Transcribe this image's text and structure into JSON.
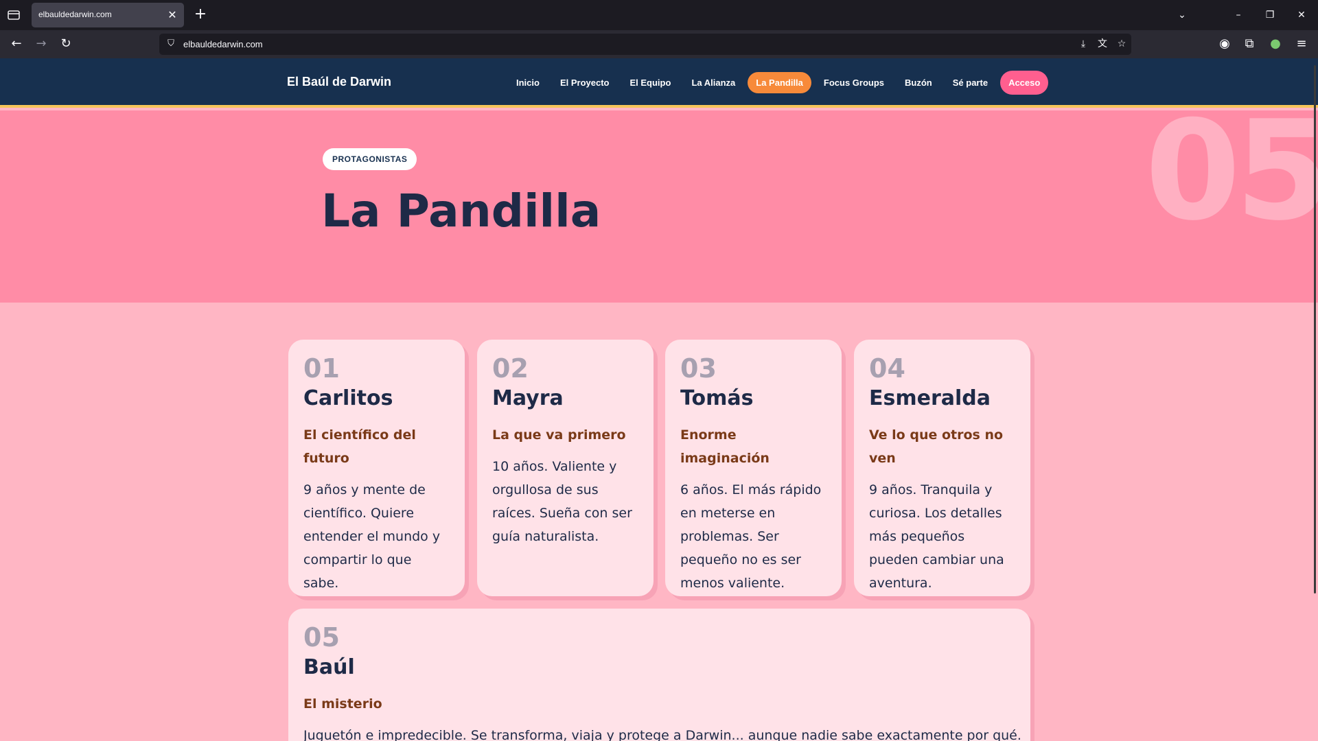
{
  "browser": {
    "tab_title": "elbauldedarwin.com",
    "url": "elbauldedarwin.com"
  },
  "site": {
    "brand": "El Baúl de Darwin",
    "menu": [
      {
        "label": "Inicio"
      },
      {
        "label": "El Proyecto"
      },
      {
        "label": "El Equipo"
      },
      {
        "label": "La Alianza"
      },
      {
        "label": "La Pandilla",
        "active": true
      },
      {
        "label": "Focus Groups"
      },
      {
        "label": "Buzón"
      },
      {
        "label": "Sé parte"
      },
      {
        "label": "Acceso",
        "cta": true
      }
    ]
  },
  "hero": {
    "number": "05",
    "pill": "PROTAGONISTAS",
    "title": "La Pandilla"
  },
  "cards": [
    {
      "num": "01",
      "name": "Carlitos",
      "role": "El científico del futuro",
      "desc": "9 años y mente de científico. Quiere entender el mundo y compartir lo que sabe."
    },
    {
      "num": "02",
      "name": "Mayra",
      "role": "La que va primero",
      "desc": "10 años. Valiente y orgullosa de sus raíces. Sueña con ser guía naturalista."
    },
    {
      "num": "03",
      "name": "Tomás",
      "role": "Enorme imaginación",
      "desc": "6 años. El más rápido en meterse en problemas. Ser pequeño no es ser menos valiente."
    },
    {
      "num": "04",
      "name": "Esmeralda",
      "role": "Ve lo que otros no ven",
      "desc": "9 años. Tranquila y curiosa. Los detalles más pequeños pueden cambiar una aventura."
    },
    {
      "num": "05",
      "name": "Baúl",
      "role": "El misterio",
      "desc": "Juguetón e impredecible. Se transforma, viaja y protege a Darwin... aunque nadie sabe exactamente por qué."
    }
  ],
  "colors": {
    "header_bg": "#17304f",
    "hero_bg": "#ff8ca6",
    "page_bg": "#ffb6c4",
    "card_bg": "#ffe2e8",
    "active_nav": "#f78a3a",
    "cta": "#ff5f8f",
    "accent_line": "#f5c55a"
  }
}
